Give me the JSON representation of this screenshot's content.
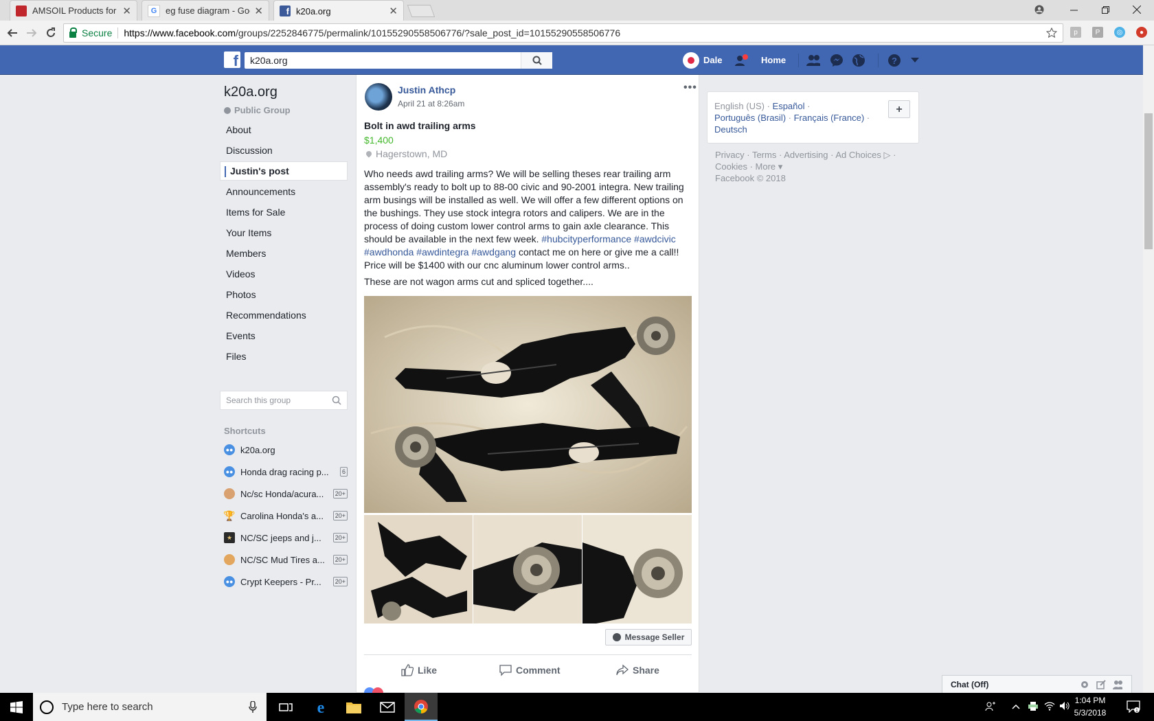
{
  "browser": {
    "tabs": [
      {
        "label": "AMSOIL Products for the",
        "favicon_color": "#c0272d"
      },
      {
        "label": "eg fuse diagram - Googl",
        "favicon_color": "#4285f4"
      },
      {
        "label": "k20a.org",
        "favicon_color": "#3b5998"
      }
    ],
    "secure_label": "Secure",
    "url_prefix": "https://www.facebook.com",
    "url_path": "/groups/2252846775/permalink/10155290558506776/?sale_post_id=10155290558506776"
  },
  "fb": {
    "search_value": "k20a.org",
    "user_name": "Dale",
    "home_label": "Home",
    "brand_color": "#4267b2"
  },
  "group": {
    "name": "k20a.org",
    "type": "Public Group",
    "nav": [
      {
        "label": "About"
      },
      {
        "label": "Discussion"
      },
      {
        "label": "Justin's post"
      },
      {
        "label": "Announcements"
      },
      {
        "label": "Items for Sale"
      },
      {
        "label": "Your Items"
      },
      {
        "label": "Members"
      },
      {
        "label": "Videos"
      },
      {
        "label": "Photos"
      },
      {
        "label": "Recommendations"
      },
      {
        "label": "Events"
      },
      {
        "label": "Files"
      }
    ],
    "search_placeholder": "Search this group",
    "shortcuts_title": "Shortcuts",
    "shortcuts": [
      {
        "label": "k20a.org",
        "badge": ""
      },
      {
        "label": "Honda drag racing p...",
        "badge": "6"
      },
      {
        "label": "Nc/sc Honda/acura...",
        "badge": "20+"
      },
      {
        "label": "Carolina Honda's a...",
        "badge": "20+"
      },
      {
        "label": "NC/SC jeeps and j...",
        "badge": "20+"
      },
      {
        "label": "NC/SC Mud Tires a...",
        "badge": "20+"
      },
      {
        "label": "Crypt Keepers - Pr...",
        "badge": "20+"
      }
    ]
  },
  "post": {
    "author": "Justin Athcp",
    "date": "April 21 at 8:26am",
    "title": "Bolt in awd trailing arms",
    "price": "$1,400",
    "location": "Hagerstown, MD",
    "body_text": "Who needs awd trailing arms? We will be selling theses rear trailing arm assembly's ready to bolt up to 88-00 civic and 90-2001 integra. New trailing arm busings will be installed as well. We will offer a few different options on the bushings. They use stock integra rotors and calipers. We are in the process of doing custom lower control arms to gain axle clearance. This should be available in the next few week.",
    "hashtags": [
      "#hubcityperformance",
      "#awdcivic",
      "#awdhonda",
      "#awdintegra",
      "#awdgang"
    ],
    "body_tail": "contact me on here or give me a call!! Price will be $1400 with our cnc aluminum lower control arms..",
    "note": "These are not wagon arms cut and spliced together....",
    "message_seller": "Message Seller",
    "actions": {
      "like": "Like",
      "comment": "Comment",
      "share": "Share"
    }
  },
  "right": {
    "lang_current": "English (US)",
    "langs": [
      "Español",
      "Português (Brasil)",
      "Français (France)",
      "Deutsch"
    ],
    "footer_links": [
      "Privacy",
      "Terms",
      "Advertising",
      "Ad Choices",
      "Cookies",
      "More"
    ],
    "copyright": "Facebook © 2018",
    "chat_label": "Chat (Off)"
  },
  "taskbar": {
    "search_placeholder": "Type here to search",
    "time": "1:04 PM",
    "date": "5/3/2018"
  }
}
